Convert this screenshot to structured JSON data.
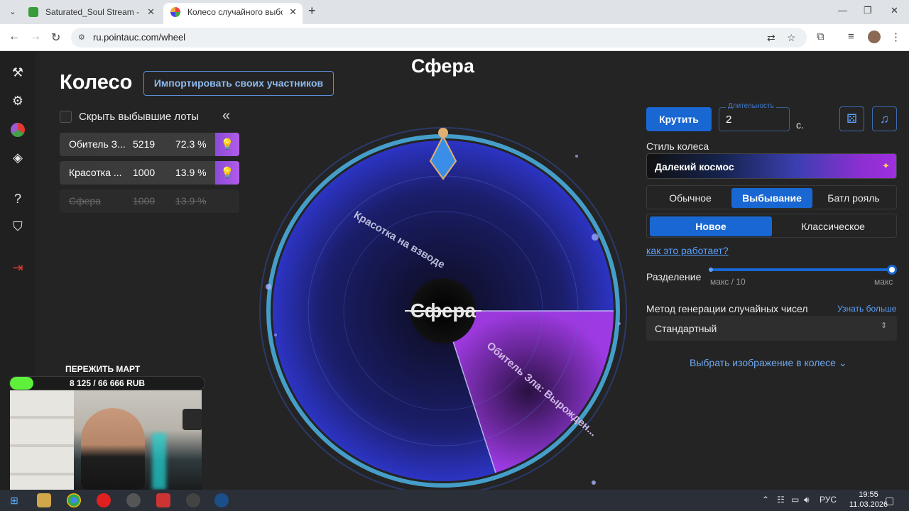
{
  "browser": {
    "tabs": [
      {
        "title": "Saturated_Soul Stream - Watch",
        "active": false
      },
      {
        "title": "Колесо случайного выбора – I",
        "active": true
      }
    ],
    "url": "ru.pointauc.com/wheel"
  },
  "page": {
    "title": "Колесо",
    "import_button": "Импортировать своих участников"
  },
  "lots_panel": {
    "hide_label": "Скрыть выбывшие лоты",
    "collapse_icon": "«",
    "lots": [
      {
        "name": "Обитель З...",
        "amount": "5219",
        "percent": "72.3 %",
        "eliminated": false
      },
      {
        "name": "Красотка ...",
        "amount": "1000",
        "percent": "13.9 %",
        "eliminated": false
      },
      {
        "name": "Сфера",
        "amount": "1000",
        "percent": "13.9 %",
        "eliminated": true
      }
    ]
  },
  "wheel": {
    "winner_title": "Сфера",
    "center_label": "Сфера",
    "segment_labels": [
      "Красотка на взводе",
      "Обитель Зла: Вырожден..."
    ],
    "colors": {
      "blue": "#2a2fb8",
      "purple": "#8a2fd8",
      "rim": "#5fd8ff"
    }
  },
  "controls": {
    "spin_button": "Крутить",
    "duration_label": "Длительность",
    "duration_value": "2",
    "duration_unit": "с.",
    "dice_icon": "dice-icon",
    "music_icon": "music-icon",
    "style_label": "Стиль колеса",
    "style_value": "Далекий космос",
    "modes": [
      "Обычное",
      "Выбывание",
      "Батл рояль"
    ],
    "mode_selected": "Выбывание",
    "variants": [
      "Новое",
      "Классическое"
    ],
    "variant_selected": "Новое",
    "how_link": "как это работает?",
    "split_label": "Разделение",
    "split_min": "макс / 10",
    "split_max": "макс",
    "split_level": 1.0,
    "rng_label": "Метод генерации случайных чисел",
    "rng_link": "Узнать больше",
    "rng_value": "Стандартный",
    "image_toggle": "Выбрать изображение в колесе"
  },
  "stream_overlay": {
    "title": "ПЕРЕЖИТЬ МАРТ",
    "progress_text": "8 125 / 66 666 RUB",
    "progress": 0.122
  },
  "taskbar": {
    "lang": "РУС",
    "time": "19:55",
    "date": "11.03.2026"
  }
}
